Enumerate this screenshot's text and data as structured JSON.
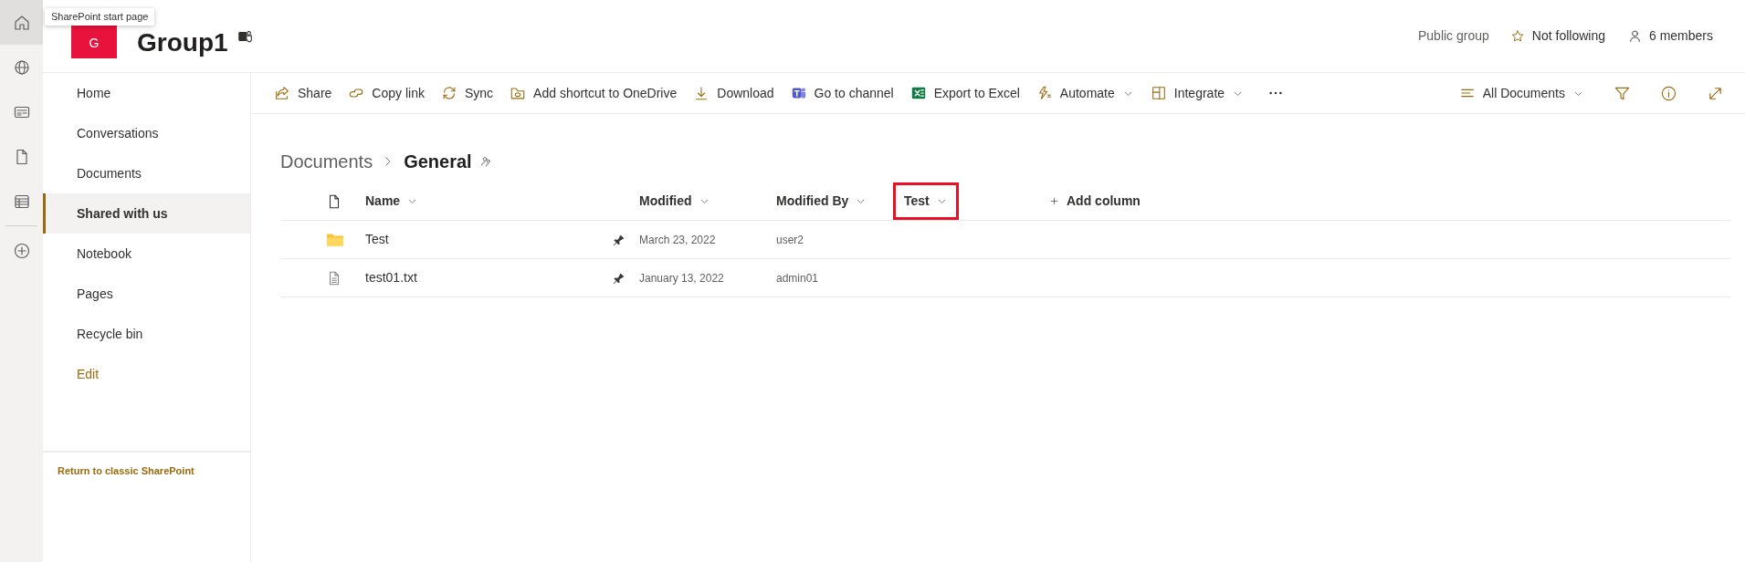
{
  "app_bar": [
    {
      "kind": "home",
      "selected": true
    },
    {
      "kind": "globe",
      "selected": false
    },
    {
      "kind": "news",
      "selected": false
    },
    {
      "kind": "file",
      "selected": false
    },
    {
      "kind": "list",
      "selected": false
    },
    {
      "kind": "create",
      "selected": false
    }
  ],
  "tooltip": "SharePoint start page",
  "site": {
    "logo": "G",
    "title": "Group1"
  },
  "header_info": {
    "privacy": "Public group",
    "follow": "Not following",
    "members": "6 members"
  },
  "nav": {
    "items": [
      {
        "label": "Home",
        "selected": false
      },
      {
        "label": "Conversations",
        "selected": false
      },
      {
        "label": "Documents",
        "selected": false
      },
      {
        "label": "Shared with us",
        "selected": true
      },
      {
        "label": "Notebook",
        "selected": false
      },
      {
        "label": "Pages",
        "selected": false
      },
      {
        "label": "Recycle bin",
        "selected": false
      }
    ],
    "edit": "Edit",
    "classic_link": "Return to classic SharePoint"
  },
  "commands": [
    {
      "label": "Share",
      "kind": "share",
      "dropdown": false
    },
    {
      "label": "Copy link",
      "kind": "link",
      "dropdown": false
    },
    {
      "label": "Sync",
      "kind": "sync",
      "dropdown": false
    },
    {
      "label": "Add shortcut to OneDrive",
      "kind": "shortcut",
      "dropdown": false
    },
    {
      "label": "Download",
      "kind": "download",
      "dropdown": false
    },
    {
      "label": "Go to channel",
      "kind": "teams",
      "dropdown": false
    },
    {
      "label": "Export to Excel",
      "kind": "excel",
      "dropdown": false
    },
    {
      "label": "Automate",
      "kind": "automate",
      "dropdown": true
    },
    {
      "label": "Integrate",
      "kind": "integrate",
      "dropdown": true
    }
  ],
  "view": {
    "label": "All Documents"
  },
  "breadcrumb": [
    {
      "label": "Documents",
      "current": false
    },
    {
      "label": "General",
      "current": true
    }
  ],
  "columns": [
    {
      "label": "Name",
      "highlighted": false
    },
    {
      "label": "Modified",
      "highlighted": false
    },
    {
      "label": "Modified By",
      "highlighted": false
    },
    {
      "label": "Test",
      "highlighted": true
    }
  ],
  "add_column": "Add column",
  "rows": [
    {
      "kind": "folder",
      "name": "Test",
      "modified": "March 23, 2022",
      "modified_by": "user2"
    },
    {
      "kind": "file",
      "name": "test01.txt",
      "modified": "January 13, 2022",
      "modified_by": "admin01"
    }
  ]
}
